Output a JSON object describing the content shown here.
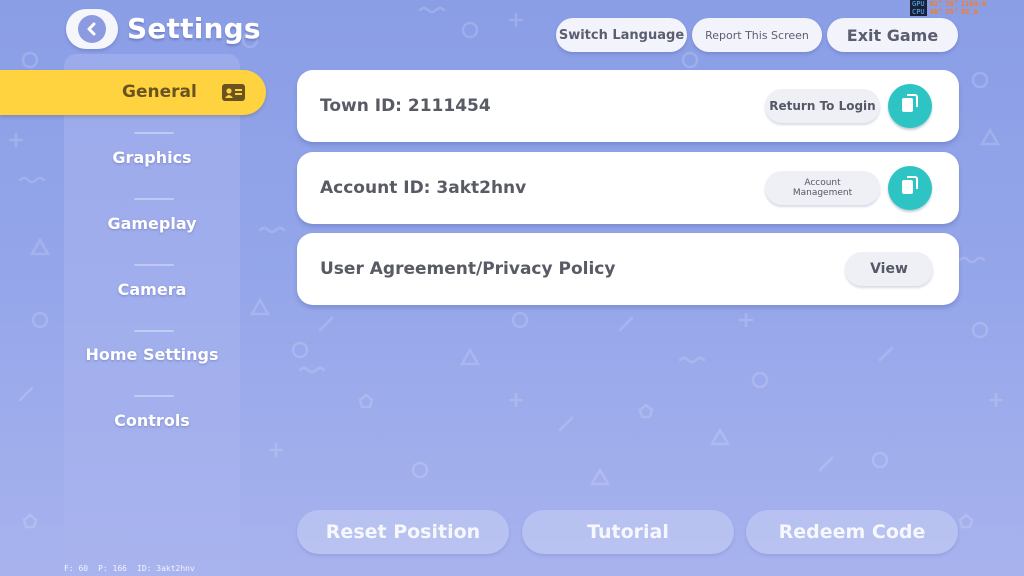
{
  "header": {
    "title": "Settings",
    "back_icon": "chevron-left-icon",
    "buttons": {
      "switch_language": "Switch Language",
      "report_screen": "Report This Screen",
      "exit_game": "Exit Game"
    }
  },
  "hud": {
    "row1": {
      "label": "GPU",
      "v1": "62°",
      "v2": "39°",
      "v3": "1104.0"
    },
    "row2": {
      "label": "CPU",
      "v1": "48°",
      "v2": "25°",
      "v3": "82.0"
    }
  },
  "sidebar": {
    "items": [
      {
        "label": "General",
        "active": true,
        "icon": "id-card-icon"
      },
      {
        "label": "Graphics",
        "active": false
      },
      {
        "label": "Gameplay",
        "active": false
      },
      {
        "label": "Camera",
        "active": false
      },
      {
        "label": "Home Settings",
        "active": false
      },
      {
        "label": "Controls",
        "active": false
      }
    ]
  },
  "cards": {
    "town": {
      "text": "Town ID: 2111454",
      "button": "Return To Login",
      "copy_icon": "copy-icon"
    },
    "account": {
      "text": "Account ID: 3akt2hnv",
      "button_line1": "Account",
      "button_line2": "Management",
      "copy_icon": "copy-icon"
    },
    "agreement": {
      "text": "User Agreement/Privacy Policy",
      "button": "View"
    }
  },
  "bottom": {
    "reset_position": "Reset Position",
    "tutorial": "Tutorial",
    "redeem_code": "Redeem Code"
  },
  "footer": {
    "fps": "F: 60",
    "ping": "P: 166",
    "id": "ID: 3akt2hnv"
  },
  "colors": {
    "background": "#8a9ee6",
    "accent_yellow": "#ffd23f",
    "copy_teal": "#2fc4c4",
    "card_text": "#585a64"
  }
}
